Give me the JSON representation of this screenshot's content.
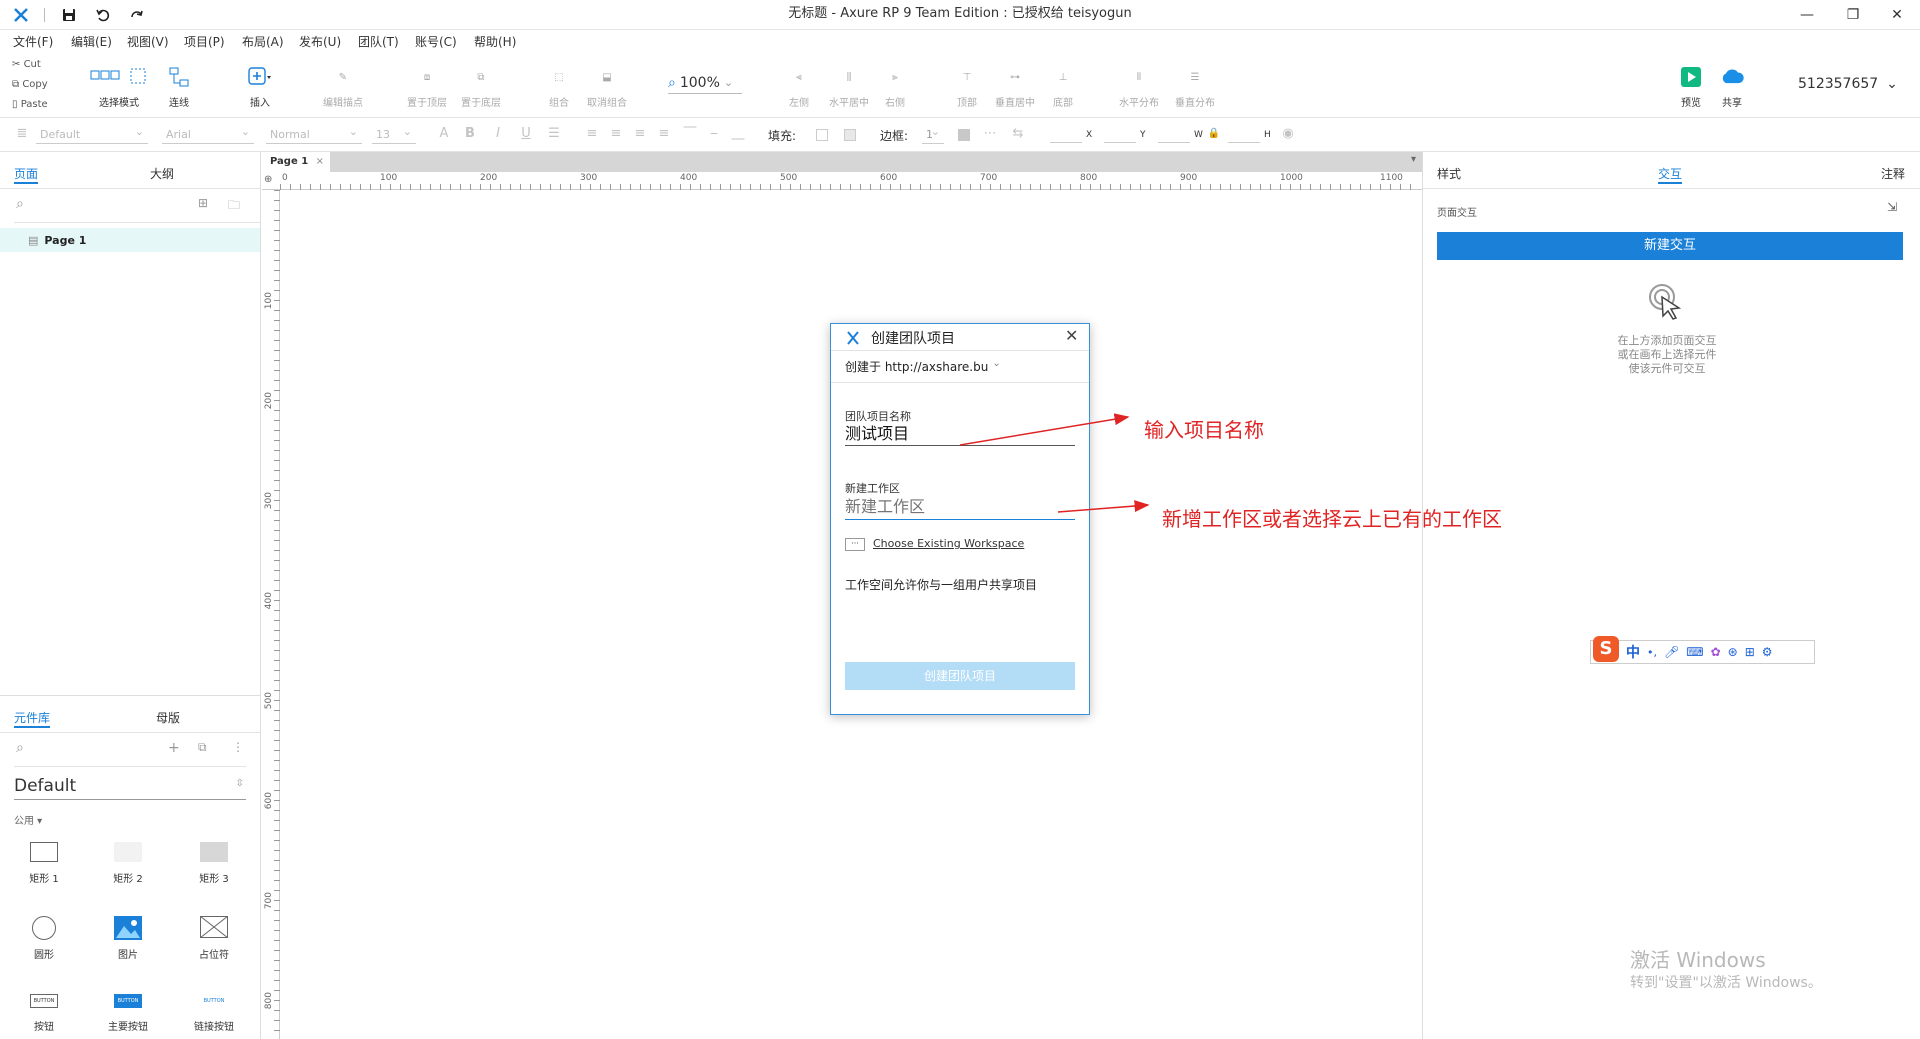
{
  "titlebar": {
    "title": "无标题 - Axure RP 9 Team Edition : 已授权给  teisyogun",
    "minimize": "—",
    "restore": "❐",
    "close": "✕"
  },
  "menus": [
    "文件(F)",
    "编辑(E)",
    "视图(V)",
    "项目(P)",
    "布局(A)",
    "发布(U)",
    "团队(T)",
    "账号(C)",
    "帮助(H)"
  ],
  "clipboard": {
    "cut": "Cut",
    "copy": "Copy",
    "paste": "Paste"
  },
  "toolbar": {
    "select_mode": "选择模式",
    "connect": "连线",
    "insert": "插入",
    "edit_point": "编辑描点",
    "bring_front": "置于顶层",
    "send_back": "置于底层",
    "group": "组合",
    "ungroup": "取消组合",
    "zoom": "100%",
    "align_left": "左侧",
    "align_hcenter": "水平居中",
    "align_right": "右侧",
    "align_top": "顶部",
    "align_vcenter": "垂直居中",
    "align_bottom": "底部",
    "dist_h": "水平分布",
    "dist_v": "垂直分布",
    "preview": "预览",
    "share": "共享",
    "account": "512357657"
  },
  "format": {
    "style": "Default",
    "font": "Arial",
    "weight": "Normal",
    "size": "13",
    "fill_label": "填充:",
    "border_label": "边框:",
    "border_width": "1",
    "x_label": "X",
    "y_label": "Y",
    "w_label": "W",
    "h_label": "H"
  },
  "leftpanel": {
    "tab_pages": "页面",
    "tab_outline": "大纲",
    "page_item": "Page 1",
    "tab_library": "元件库",
    "tab_masters": "母版",
    "library_name": "Default",
    "section_title": "公用 ▾",
    "widgets": [
      "矩形 1",
      "矩形 2",
      "矩形 3",
      "圆形",
      "图片",
      "占位符",
      "按钮",
      "主要按钮",
      "链接按钮"
    ],
    "button_text": "BUTTON"
  },
  "canvas": {
    "page_tab": "Page 1",
    "ruler_h": [
      "0",
      "100",
      "200",
      "300",
      "400",
      "500",
      "600",
      "700",
      "800",
      "900",
      "1000",
      "1100"
    ],
    "ruler_v": [
      "100",
      "200",
      "300",
      "400",
      "500",
      "600",
      "700",
      "800"
    ]
  },
  "rightpanel": {
    "tab_style": "样式",
    "tab_interaction": "交互",
    "tab_notes": "注释",
    "page_interaction": "页面交互",
    "new_interaction": "新建交互",
    "hint_line1": "在上方添加页面交互",
    "hint_line2": "或在画布上选择元件",
    "hint_line3": "使该元件可交互"
  },
  "dialog": {
    "title": "创建团队项目",
    "host": "创建于 http://axshare.bu",
    "name_label": "团队项目名称",
    "name_value": "测试项目",
    "workspace_label": "新建工作区",
    "workspace_placeholder": "新建工作区",
    "choose_button": "···",
    "choose_link": "Choose Existing Workspace",
    "description": "工作空间允许你与一组用户共享项目",
    "create_button": "创建团队项目"
  },
  "annotations": {
    "arrow1_text": "输入项目名称",
    "arrow2_text": "新增工作区或者选择云上已有的工作区"
  },
  "ime": {
    "lang": "中",
    "punct": "•,"
  },
  "watermark": {
    "line1": "激活 Windows",
    "line2": "转到\"设置\"以激活 Windows。"
  },
  "colors": {
    "accent": "#1a80d8",
    "annotation": "#e02424"
  }
}
